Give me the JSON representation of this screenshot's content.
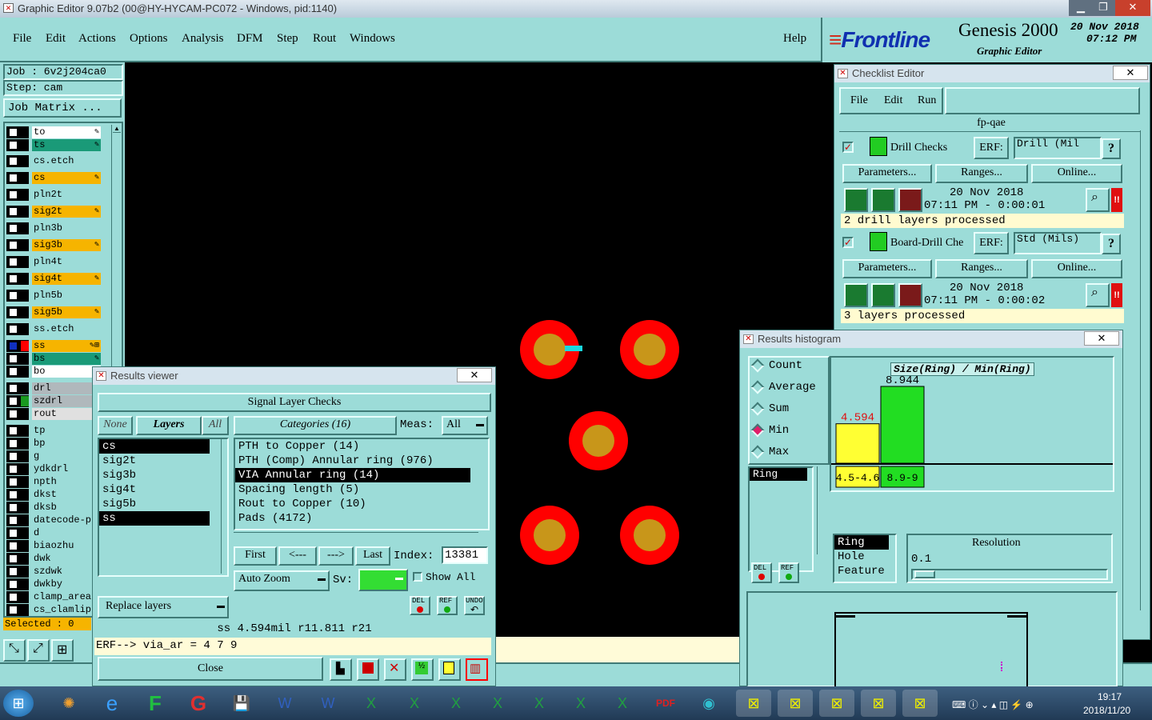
{
  "window": {
    "title": "Graphic Editor 9.07b2 (00@HY-HYCAM-PC072 - Windows, pid:1140)"
  },
  "menu": [
    "File",
    "Edit",
    "Actions",
    "Options",
    "Analysis",
    "DFM",
    "Step",
    "Rout",
    "Windows"
  ],
  "help": "Help",
  "brand": {
    "logo": "Frontline",
    "product": "Genesis 2000",
    "subtitle": "Graphic Editor",
    "date": "20 Nov 2018",
    "time": "07:12 PM"
  },
  "job": {
    "job": "Job  :  6v2j204ca0",
    "step": "Step: cam",
    "matrix": "Job Matrix ..."
  },
  "layers": [
    {
      "name": "to",
      "bg": "#ffffff",
      "mark": "✎"
    },
    {
      "name": "ts",
      "bg": "#1a9a78",
      "mark": "✎"
    },
    {
      "name": "cs.etch",
      "bg": "#9cdcd8",
      "mark": ""
    },
    {
      "name": "cs",
      "bg": "#f6b400",
      "mark": "✎"
    },
    {
      "name": "pln2t",
      "bg": "#9cdcd8",
      "mark": ""
    },
    {
      "name": "sig2t",
      "bg": "#f6b400",
      "mark": "✎"
    },
    {
      "name": "pln3b",
      "bg": "#9cdcd8",
      "mark": ""
    },
    {
      "name": "sig3b",
      "bg": "#f6b400",
      "mark": "✎"
    },
    {
      "name": "pln4t",
      "bg": "#9cdcd8",
      "mark": ""
    },
    {
      "name": "sig4t",
      "bg": "#f6b400",
      "mark": "✎"
    },
    {
      "name": "pln5b",
      "bg": "#9cdcd8",
      "mark": ""
    },
    {
      "name": "sig5b",
      "bg": "#f6b400",
      "mark": "✎"
    },
    {
      "name": "ss.etch",
      "bg": "#9cdcd8",
      "mark": ""
    },
    {
      "name": "ss",
      "bg": "#f6b400",
      "mark": "✎⊞"
    },
    {
      "name": "bs",
      "bg": "#1a9a78",
      "mark": "✎"
    },
    {
      "name": "bo",
      "bg": "#ffffff",
      "mark": ""
    },
    {
      "name": "drl",
      "bg": "#b0b8bc",
      "mark": ""
    },
    {
      "name": "szdrl",
      "bg": "#b0b8bc",
      "mark": ""
    },
    {
      "name": "rout",
      "bg": "#e0e0e0",
      "mark": ""
    },
    {
      "name": "tp",
      "bg": "#9cdcd8",
      "mark": ""
    },
    {
      "name": "bp",
      "bg": "#9cdcd8",
      "mark": ""
    },
    {
      "name": "g",
      "bg": "#9cdcd8",
      "mark": ""
    },
    {
      "name": "ydkdrl",
      "bg": "#9cdcd8",
      "mark": ""
    },
    {
      "name": "npth",
      "bg": "#9cdcd8",
      "mark": ""
    },
    {
      "name": "dkst",
      "bg": "#9cdcd8",
      "mark": ""
    },
    {
      "name": "dksb",
      "bg": "#9cdcd8",
      "mark": ""
    },
    {
      "name": "datecode-p",
      "bg": "#9cdcd8",
      "mark": ""
    },
    {
      "name": "d",
      "bg": "#9cdcd8",
      "mark": ""
    },
    {
      "name": "biaozhu",
      "bg": "#9cdcd8",
      "mark": ""
    },
    {
      "name": "dwk",
      "bg": "#9cdcd8",
      "mark": ""
    },
    {
      "name": "szdwk",
      "bg": "#9cdcd8",
      "mark": ""
    },
    {
      "name": "dwkby",
      "bg": "#9cdcd8",
      "mark": ""
    },
    {
      "name": "clamp_area",
      "bg": "#9cdcd8",
      "mark": ""
    },
    {
      "name": "cs_clamlip",
      "bg": "#9cdcd8",
      "mark": ""
    }
  ],
  "selected": "Selected : 0",
  "checklist": {
    "title": "Checklist Editor",
    "menu": [
      "File",
      "Edit",
      "Run"
    ],
    "name": "fp-qae",
    "items": [
      {
        "name": "Drill Checks",
        "erf": "ERF:",
        "erf_value": "Drill (Mil",
        "params": "Parameters...",
        "ranges": "Ranges...",
        "online": "Online...",
        "date": "20 Nov 2018",
        "time": "07:11  PM - 0:00:01",
        "status": "2 drill layers processed"
      },
      {
        "name": "Board-Drill Che",
        "erf": "ERF:",
        "erf_value": "Std (Mils)",
        "params": "Parameters...",
        "ranges": "Ranges...",
        "online": "Online...",
        "date": "20 Nov 2018",
        "time": "07:11  PM - 0:00:02",
        "status": "3 layers processed"
      }
    ]
  },
  "results": {
    "title": "Results viewer",
    "header": "Signal Layer Checks",
    "none": "None",
    "layers": "Layers",
    "all": "All",
    "layer_list": [
      "cs",
      "sig2t",
      "sig3b",
      "sig4t",
      "sig5b",
      "ss"
    ],
    "categories": "Categories (16)",
    "meas_label": "Meas:",
    "meas_value": "All",
    "cat_list": [
      "PTH to Copper (14)",
      "PTH (Comp) Annular ring (976)",
      "VIA Annular ring (14)",
      "Spacing length (5)",
      "Rout to Copper (10)",
      "Pads (4172)"
    ],
    "nav": {
      "first": "First",
      "prev": "<---",
      "next": "--->",
      "last": "Last",
      "index_label": "Index:",
      "index": "13381"
    },
    "auto_zoom": "Auto Zoom",
    "sv": "Sv:",
    "show_all": "Show All",
    "replace": "Replace layers",
    "del": "DEL",
    "ref": "REF",
    "undo": "UNDO",
    "measure": "ss 4.594mil  r11.811  r21",
    "erf": "ERF--> via_ar = 4 7 9",
    "close": "Close"
  },
  "histogram": {
    "title": "Results histogram",
    "modes": [
      "Count",
      "Average",
      "Sum",
      "Min",
      "Max"
    ],
    "selected_mode": "Min",
    "label": "Size(Ring) / Min(Ring)",
    "field": "Ring",
    "attrs": [
      "Ring",
      "Hole",
      "Feature"
    ],
    "resolution_label": "Resolution",
    "resolution": "0.1",
    "del": "DEL",
    "ref": "REF"
  },
  "chart_data": {
    "type": "bar",
    "title": "Size(Ring) / Min(Ring)",
    "categories": [
      "4.5-4.6",
      "8.9-9"
    ],
    "values": [
      4.594,
      8.944
    ],
    "colors": [
      "#ffff33",
      "#22dd22"
    ]
  },
  "taskbar": {
    "time": "19:17",
    "date": "2018/11/20"
  }
}
